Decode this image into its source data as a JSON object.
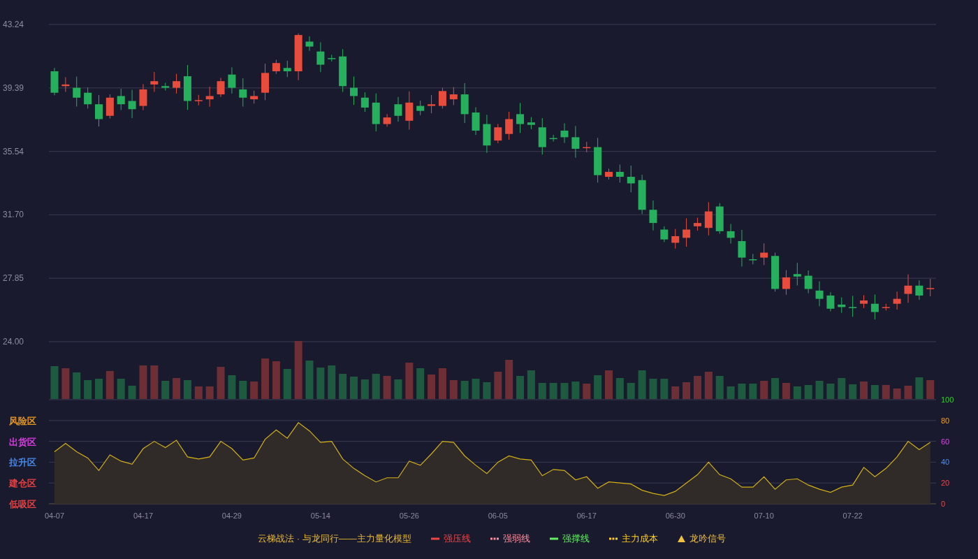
{
  "price_chart": {
    "chart_data": {
      "type": "candlestick",
      "ylim": [
        24.0,
        43.24
      ],
      "grid": true,
      "yticks": [
        {
          "value": 43.24,
          "label": "43.24"
        },
        {
          "value": 39.39,
          "label": "39.39"
        },
        {
          "value": 35.54,
          "label": "35.54"
        },
        {
          "value": 31.7,
          "label": "31.70"
        },
        {
          "value": 27.85,
          "label": "27.85"
        },
        {
          "value": 24.0,
          "label": "24.00"
        }
      ],
      "ohlc": [
        [
          40.4,
          40.6,
          38.94,
          39.1
        ],
        [
          39.5,
          40.04,
          39.15,
          39.6
        ],
        [
          39.4,
          40.08,
          38.26,
          38.8
        ],
        [
          39.1,
          39.42,
          38.14,
          38.4
        ],
        [
          38.4,
          38.96,
          37.05,
          37.5
        ],
        [
          37.7,
          39.0,
          37.54,
          38.8
        ],
        [
          38.9,
          39.34,
          38.05,
          38.4
        ],
        [
          38.6,
          39.28,
          37.56,
          38.1
        ],
        [
          38.3,
          39.62,
          38.04,
          39.3
        ],
        [
          39.6,
          40.36,
          39.15,
          39.8
        ],
        [
          39.5,
          39.7,
          39.24,
          39.4
        ],
        [
          39.4,
          40.24,
          39.05,
          39.8
        ],
        [
          40.1,
          40.78,
          38.06,
          38.6
        ],
        [
          38.6,
          38.97,
          38.34,
          38.65
        ],
        [
          38.7,
          39.46,
          38.25,
          38.9
        ],
        [
          39.0,
          40.0,
          38.84,
          39.8
        ],
        [
          40.2,
          40.64,
          39.05,
          39.4
        ],
        [
          39.3,
          39.98,
          38.26,
          38.8
        ],
        [
          38.7,
          39.22,
          38.44,
          38.9
        ],
        [
          39.1,
          40.86,
          38.65,
          40.3
        ],
        [
          40.4,
          41.1,
          40.24,
          40.9
        ],
        [
          40.6,
          41.04,
          40.05,
          40.4
        ],
        [
          40.4,
          42.7,
          39.86,
          42.6
        ],
        [
          42.2,
          42.52,
          41.64,
          41.9
        ],
        [
          41.6,
          42.16,
          40.35,
          40.8
        ],
        [
          41.2,
          41.4,
          40.99,
          41.15
        ],
        [
          41.3,
          41.74,
          39.15,
          39.5
        ],
        [
          39.4,
          40.08,
          38.36,
          38.9
        ],
        [
          38.8,
          39.12,
          37.94,
          38.2
        ],
        [
          38.5,
          39.06,
          36.75,
          37.2
        ],
        [
          37.2,
          37.8,
          37.04,
          37.6
        ],
        [
          38.4,
          38.84,
          37.35,
          37.7
        ],
        [
          37.4,
          39.18,
          36.86,
          38.5
        ],
        [
          38.3,
          38.62,
          37.74,
          38.0
        ],
        [
          38.3,
          38.96,
          37.85,
          38.4
        ],
        [
          38.3,
          39.4,
          38.14,
          39.2
        ],
        [
          38.7,
          39.44,
          38.35,
          39.0
        ],
        [
          39.0,
          39.68,
          37.26,
          37.8
        ],
        [
          37.9,
          38.22,
          36.54,
          36.8
        ],
        [
          37.2,
          37.76,
          35.45,
          35.9
        ],
        [
          36.2,
          37.2,
          36.04,
          37.0
        ],
        [
          36.6,
          37.94,
          36.25,
          37.5
        ],
        [
          37.8,
          38.48,
          36.66,
          37.2
        ],
        [
          37.3,
          37.62,
          36.89,
          37.15
        ],
        [
          37.0,
          37.56,
          35.35,
          35.8
        ],
        [
          36.35,
          36.55,
          36.14,
          36.3
        ],
        [
          36.8,
          37.24,
          36.05,
          36.4
        ],
        [
          36.4,
          37.08,
          35.16,
          35.7
        ],
        [
          35.75,
          36.12,
          35.49,
          35.8
        ],
        [
          35.8,
          36.36,
          33.65,
          34.1
        ],
        [
          34.0,
          34.5,
          33.84,
          34.3
        ],
        [
          34.3,
          34.74,
          33.65,
          34.0
        ],
        [
          34.0,
          34.68,
          33.06,
          33.6
        ],
        [
          33.8,
          34.12,
          31.74,
          32.0
        ],
        [
          32.0,
          32.56,
          30.75,
          31.2
        ],
        [
          30.8,
          31.0,
          30.04,
          30.2
        ],
        [
          30.0,
          30.84,
          29.65,
          30.4
        ],
        [
          30.3,
          31.48,
          29.76,
          30.8
        ],
        [
          31.0,
          31.52,
          30.74,
          31.2
        ],
        [
          30.9,
          32.46,
          30.45,
          31.9
        ],
        [
          32.2,
          32.4,
          30.54,
          30.7
        ],
        [
          30.7,
          31.14,
          29.95,
          30.3
        ],
        [
          30.1,
          30.78,
          28.56,
          29.1
        ],
        [
          29.0,
          29.32,
          28.69,
          28.95
        ],
        [
          29.1,
          29.96,
          28.65,
          29.4
        ],
        [
          29.2,
          29.4,
          27.04,
          27.2
        ],
        [
          27.2,
          28.34,
          26.85,
          27.9
        ],
        [
          28.1,
          28.78,
          27.41,
          27.95
        ],
        [
          28.0,
          28.32,
          26.94,
          27.2
        ],
        [
          27.1,
          27.66,
          26.15,
          26.6
        ],
        [
          26.8,
          27.0,
          25.84,
          26.0
        ],
        [
          26.25,
          26.69,
          25.75,
          26.1
        ],
        [
          26.1,
          26.78,
          25.51,
          26.05
        ],
        [
          26.3,
          26.82,
          26.04,
          26.5
        ],
        [
          26.3,
          26.86,
          25.35,
          25.8
        ],
        [
          26.05,
          26.3,
          25.89,
          26.1
        ],
        [
          26.3,
          27.04,
          25.95,
          26.6
        ],
        [
          26.9,
          28.08,
          26.36,
          27.4
        ],
        [
          27.4,
          27.72,
          26.54,
          26.8
        ],
        [
          27.2,
          27.81,
          26.75,
          27.25
        ]
      ]
    }
  },
  "oscillator": {
    "zones": [
      {
        "label": "风险区",
        "color": "#f0a020"
      },
      {
        "label": "出货区",
        "color": "#e040e8"
      },
      {
        "label": "拉升区",
        "color": "#4a8ff0"
      },
      {
        "label": "建仓区",
        "color": "#f04545"
      },
      {
        "label": "低吸区",
        "color": "#f04545"
      }
    ],
    "chart_data": {
      "type": "area",
      "ylim": [
        0,
        100
      ],
      "grid": true,
      "yticks": [
        {
          "value": 100,
          "label": "100"
        },
        {
          "value": 80,
          "label": "80"
        },
        {
          "value": 60,
          "label": "60"
        },
        {
          "value": 40,
          "label": "40"
        },
        {
          "value": 20,
          "label": "20"
        },
        {
          "value": 0,
          "label": "0"
        }
      ],
      "series": [
        {
          "color": "#d4b014",
          "values": [
            50,
            58,
            50,
            44,
            32,
            47,
            41,
            38,
            53,
            60,
            54,
            61,
            45,
            43,
            45,
            60,
            53,
            42,
            44,
            62,
            71,
            63,
            78,
            70,
            59,
            60,
            43,
            34,
            27,
            21,
            25,
            25,
            41,
            37,
            48,
            60,
            59,
            46,
            37,
            29,
            40,
            46,
            43,
            42,
            27,
            33,
            32,
            23,
            26,
            15,
            21,
            20,
            19,
            13,
            10,
            8,
            12,
            20,
            28,
            40,
            28,
            24,
            16,
            16,
            26,
            14,
            23,
            24,
            18,
            14,
            11,
            16,
            18,
            35,
            26,
            34,
            45,
            60,
            52,
            59
          ]
        }
      ]
    }
  },
  "date_axis": [
    "04-07",
    "04-17",
    "04-29",
    "05-14",
    "05-26",
    "06-05",
    "06-17",
    "06-30",
    "07-10",
    "07-22"
  ],
  "legend": {
    "title": "云梯战法 · 与龙同行——主力量化模型",
    "items": [
      {
        "label": "强压线",
        "kind": "solid",
        "color": "#f04545"
      },
      {
        "label": "强弱线",
        "kind": "dashed",
        "color": "#ff8fa0"
      },
      {
        "label": "强撑线",
        "kind": "solid",
        "color": "#60f060"
      },
      {
        "label": "主力成本",
        "kind": "dashed",
        "color": "#ffd020"
      },
      {
        "label": "龙吟信号",
        "kind": "triangle",
        "color": "#f0c040"
      }
    ]
  }
}
